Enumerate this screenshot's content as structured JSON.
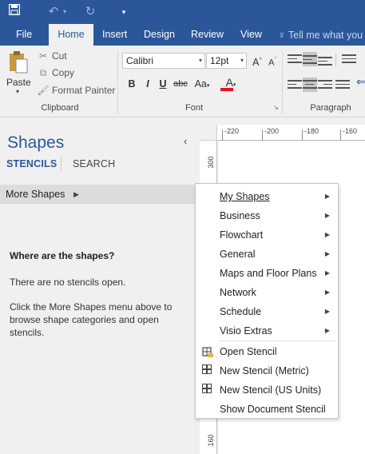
{
  "quick_access": {
    "save_icon": "save-icon",
    "undo_icon": "undo-icon",
    "redo_icon": "redo-icon",
    "customize_icon": "customize-qat-icon"
  },
  "tabs": [
    {
      "label": "File"
    },
    {
      "label": "Home"
    },
    {
      "label": "Insert"
    },
    {
      "label": "Design"
    },
    {
      "label": "Review"
    },
    {
      "label": "View"
    }
  ],
  "tell_me": "Tell me what you",
  "clipboard": {
    "paste": "Paste",
    "cut": "Cut",
    "copy": "Copy",
    "format_painter": "Format Painter",
    "group": "Clipboard"
  },
  "font": {
    "name": "Calibri",
    "size": "12pt",
    "grow": "A",
    "shrink": "A",
    "bold": "B",
    "italic": "I",
    "underline": "U",
    "strike": "abc",
    "case": "Aa",
    "color_label": "A",
    "group": "Font"
  },
  "paragraph": {
    "group": "Paragraph"
  },
  "shapes_pane": {
    "title": "Shapes",
    "tab_stencils": "STENCILS",
    "tab_search": "SEARCH",
    "more_shapes": "More Shapes",
    "where_heading": "Where are the shapes?",
    "no_stencils": "There are no stencils open.",
    "instructions": "Click the More Shapes menu above to browse shape categories and open stencils."
  },
  "ruler": {
    "h_labels": [
      "-220",
      "-200",
      "-180",
      "-160"
    ],
    "v_labels": [
      "300",
      "160"
    ]
  },
  "menu": {
    "items": [
      {
        "label": "My Shapes",
        "submenu": true
      },
      {
        "label": "Business",
        "submenu": true
      },
      {
        "label": "Flowchart",
        "submenu": true
      },
      {
        "label": "General",
        "submenu": true
      },
      {
        "label": "Maps and Floor Plans",
        "submenu": true
      },
      {
        "label": "Network",
        "submenu": true
      },
      {
        "label": "Schedule",
        "submenu": true
      },
      {
        "label": "Visio Extras",
        "submenu": true
      },
      {
        "label": "Open Stencil",
        "icon": "open-stencil-icon"
      },
      {
        "label": "New Stencil (Metric)",
        "icon": "new-stencil-icon"
      },
      {
        "label": "New Stencil (US Units)",
        "icon": "new-stencil-icon"
      },
      {
        "label": "Show Document Stencil"
      }
    ]
  },
  "colors": {
    "accent": "#2b579a",
    "font_color_bar": "#e81123"
  }
}
